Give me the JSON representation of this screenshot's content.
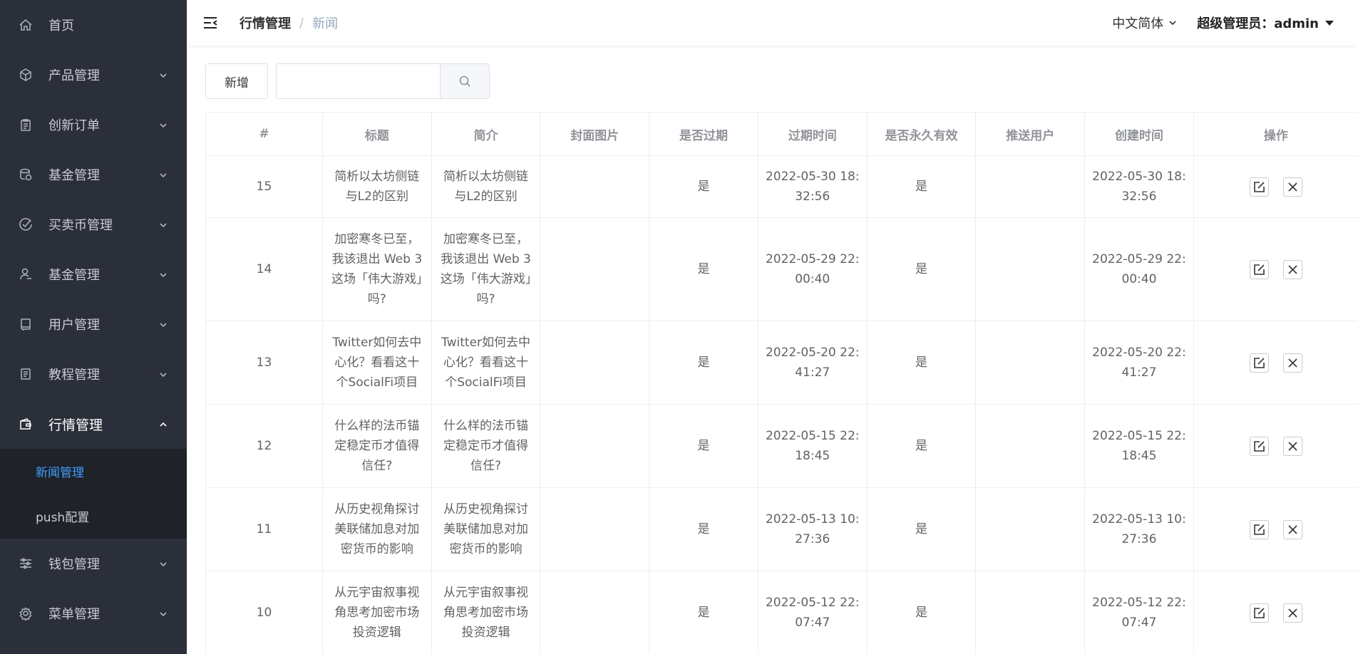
{
  "sidebar": {
    "items": [
      {
        "label": "首页",
        "icon": "home-icon"
      },
      {
        "label": "产品管理",
        "icon": "box-icon"
      },
      {
        "label": "创新订单",
        "icon": "clipboard-icon"
      },
      {
        "label": "基金管理",
        "icon": "database-icon"
      },
      {
        "label": "买卖币管理",
        "icon": "check-circle-icon"
      },
      {
        "label": "基金管理",
        "icon": "user-icon"
      },
      {
        "label": "用户管理",
        "icon": "notebook-icon"
      },
      {
        "label": "教程管理",
        "icon": "document-icon"
      },
      {
        "label": "行情管理",
        "icon": "wallet-icon"
      },
      {
        "label": "钱包管理",
        "icon": "sliders-icon"
      },
      {
        "label": "菜单管理",
        "icon": "gear-icon"
      }
    ],
    "submenu": [
      {
        "label": "新闻管理",
        "active": true
      },
      {
        "label": "push配置",
        "active": false
      }
    ],
    "accent_color": "#409eff"
  },
  "header": {
    "breadcrumb_first": "行情管理",
    "breadcrumb_sep": "/",
    "breadcrumb_last": "新闻",
    "language": "中文简体",
    "user": "超级管理员：admin"
  },
  "toolbar": {
    "add_label": "新增",
    "search_placeholder": ""
  },
  "table": {
    "columns": [
      "#",
      "标题",
      "简介",
      "封面图片",
      "是否过期",
      "过期时间",
      "是否永久有效",
      "推送用户",
      "创建时间",
      "操作"
    ],
    "rows": [
      {
        "id": "15",
        "title": "简析以太坊侧链与L2的区别",
        "summary": "简析以太坊侧链与L2的区别",
        "cover": "",
        "expired": "是",
        "expire_time": "2022-05-30 18:32:56",
        "permanent": "是",
        "push_user": "",
        "created": "2022-05-30 18:32:56"
      },
      {
        "id": "14",
        "title": "加密寒冬已至，我该退出 Web 3 这场「伟大游戏」吗?",
        "summary": "加密寒冬已至，我该退出 Web 3 这场「伟大游戏」吗?",
        "cover": "",
        "expired": "是",
        "expire_time": "2022-05-29 22:00:40",
        "permanent": "是",
        "push_user": "",
        "created": "2022-05-29 22:00:40"
      },
      {
        "id": "13",
        "title": "Twitter如何去中心化？看看这十个SocialFi项目",
        "summary": "Twitter如何去中心化？看看这十个SocialFi项目",
        "cover": "",
        "expired": "是",
        "expire_time": "2022-05-20 22:41:27",
        "permanent": "是",
        "push_user": "",
        "created": "2022-05-20 22:41:27"
      },
      {
        "id": "12",
        "title": "什么样的法币锚定稳定币才值得信任?",
        "summary": "什么样的法币锚定稳定币才值得信任?",
        "cover": "",
        "expired": "是",
        "expire_time": "2022-05-15 22:18:45",
        "permanent": "是",
        "push_user": "",
        "created": "2022-05-15 22:18:45"
      },
      {
        "id": "11",
        "title": "从历史视角探讨美联储加息对加密货币的影响",
        "summary": "从历史视角探讨美联储加息对加密货币的影响",
        "cover": "",
        "expired": "是",
        "expire_time": "2022-05-13 10:27:36",
        "permanent": "是",
        "push_user": "",
        "created": "2022-05-13 10:27:36"
      },
      {
        "id": "10",
        "title": "从元宇宙叙事视角思考加密市场投资逻辑",
        "summary": "从元宇宙叙事视角思考加密市场投资逻辑",
        "cover": "",
        "expired": "是",
        "expire_time": "2022-05-12 22:07:47",
        "permanent": "是",
        "push_user": "",
        "created": "2022-05-12 22:07:47"
      }
    ]
  }
}
